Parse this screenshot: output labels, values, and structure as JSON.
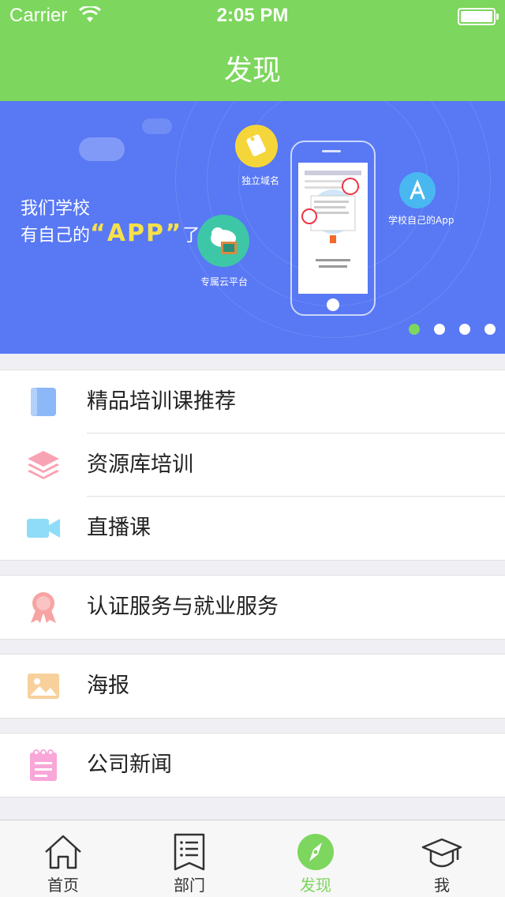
{
  "status_bar": {
    "carrier": "Carrier",
    "time": "2:05 PM"
  },
  "nav": {
    "title": "发现"
  },
  "banner": {
    "line1": "我们学校",
    "line2_prefix": "有自己的",
    "line2_highlight": "“APP”",
    "line2_suffix": "了",
    "badges": [
      "独立域名",
      "专属云平台",
      "学校自己的App"
    ],
    "active_page": 1,
    "page_count": 4
  },
  "menu_groups": [
    {
      "items": [
        {
          "label": "精品培训课推荐",
          "icon": "book-icon",
          "color": "#8cb8f8"
        },
        {
          "label": "资源库培训",
          "icon": "layers-icon",
          "color": "#f8a3b4"
        },
        {
          "label": "直播课",
          "icon": "video-camera-icon",
          "color": "#8fdcf8"
        }
      ]
    },
    {
      "items": [
        {
          "label": "认证服务与就业服务",
          "icon": "award-ribbon-icon",
          "color": "#f8a3a3"
        }
      ]
    },
    {
      "items": [
        {
          "label": "海报",
          "icon": "image-icon",
          "color": "#f8d09b"
        }
      ]
    },
    {
      "items": [
        {
          "label": "公司新闻",
          "icon": "notepad-icon",
          "color": "#f8a7d8"
        }
      ]
    }
  ],
  "tabs": [
    {
      "label": "首页",
      "icon": "home-icon"
    },
    {
      "label": "部门",
      "icon": "document-list-icon"
    },
    {
      "label": "发现",
      "icon": "compass-icon",
      "active": true
    },
    {
      "label": "我",
      "icon": "graduation-cap-icon"
    }
  ],
  "colors": {
    "accent": "#7dd65d",
    "banner_bg": "#5878f4",
    "highlight": "#f6e14a"
  }
}
